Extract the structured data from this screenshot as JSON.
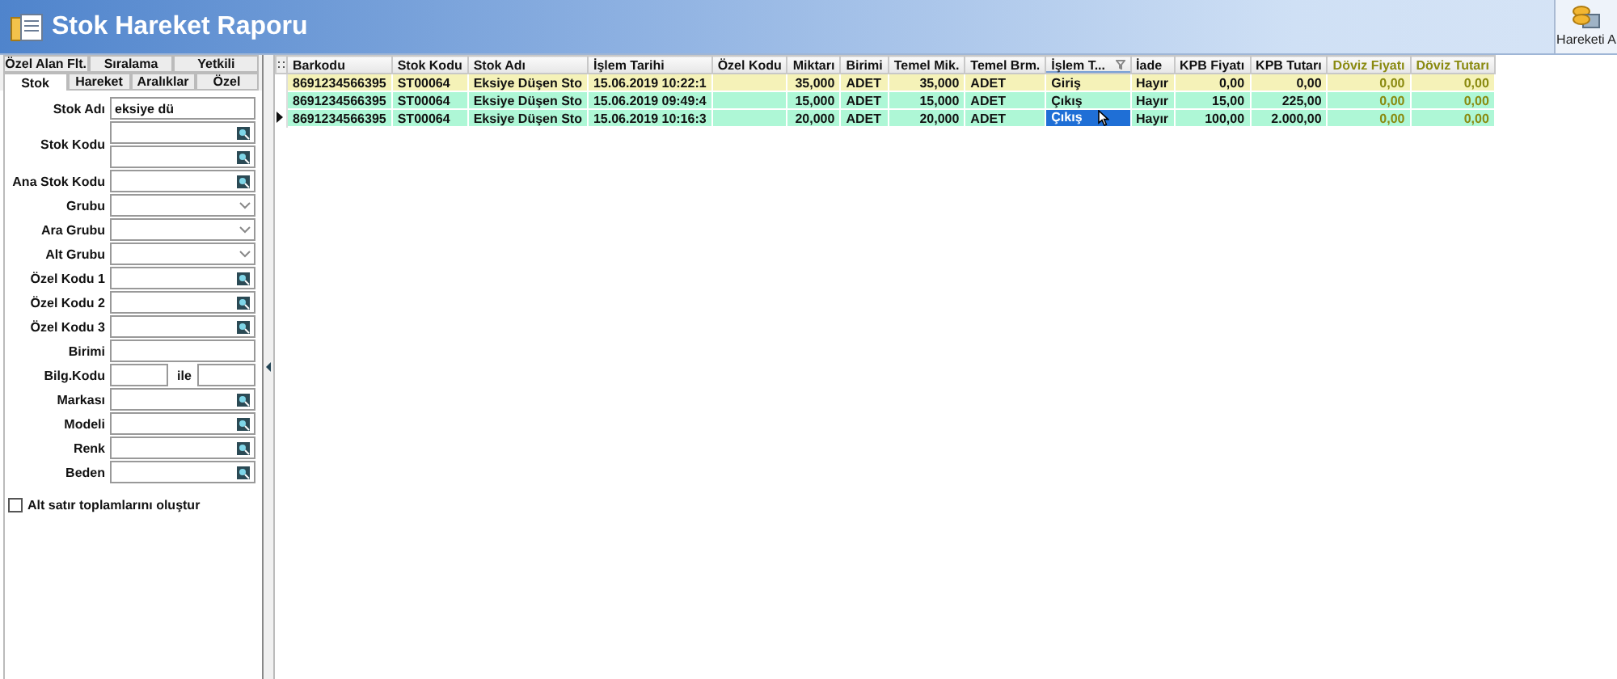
{
  "window": {
    "title": "Stok Hareket Raporu"
  },
  "toolbar": {
    "buttons": [
      {
        "label": "Hareketi A"
      }
    ]
  },
  "filter_tabs_back": [
    {
      "label": "Özel Alan Flt.",
      "selected": false
    },
    {
      "label": "Sıralama",
      "selected": false
    },
    {
      "label": "Yetkili",
      "selected": false
    }
  ],
  "filter_tabs_front": [
    {
      "label": "Stok",
      "selected": true
    },
    {
      "label": "Hareket",
      "selected": false
    },
    {
      "label": "Aralıklar",
      "selected": false
    },
    {
      "label": "Özel",
      "selected": false
    }
  ],
  "filter_fields": [
    {
      "label": "Stok Adı",
      "kind": "text",
      "value": "eksiye dü"
    },
    {
      "label": "Stok Kodu",
      "kind": "lookup-pair"
    },
    {
      "label": "Ana Stok Kodu",
      "kind": "lookup"
    },
    {
      "label": "Grubu",
      "kind": "dropdown"
    },
    {
      "label": "Ara Grubu",
      "kind": "dropdown"
    },
    {
      "label": "Alt Grubu",
      "kind": "dropdown"
    },
    {
      "label": "Özel Kodu 1",
      "kind": "lookup"
    },
    {
      "label": "Özel Kodu 2",
      "kind": "lookup"
    },
    {
      "label": "Özel Kodu 3",
      "kind": "lookup"
    },
    {
      "label": "Birimi",
      "kind": "text"
    },
    {
      "label": "Bilg.Kodu",
      "kind": "range",
      "separator": "ile"
    },
    {
      "label": "Markası",
      "kind": "lookup"
    },
    {
      "label": "Modeli",
      "kind": "lookup"
    },
    {
      "label": "Renk",
      "kind": "lookup"
    },
    {
      "label": "Beden",
      "kind": "lookup"
    }
  ],
  "subtotal_checkbox": {
    "label": "Alt satır toplamlarını oluştur",
    "checked": false
  },
  "table": {
    "columns": [
      {
        "label": "Barkodu",
        "kind": "text",
        "filter": false,
        "focused": false
      },
      {
        "label": "Stok Kodu",
        "kind": "text",
        "filter": false,
        "focused": false
      },
      {
        "label": "Stok Adı",
        "kind": "text",
        "filter": false,
        "focused": false
      },
      {
        "label": "İşlem Tarihi",
        "kind": "text",
        "filter": false,
        "focused": false
      },
      {
        "label": "Özel Kodu",
        "kind": "text",
        "filter": false,
        "focused": false
      },
      {
        "label": "Miktarı",
        "kind": "number",
        "filter": false,
        "focused": false
      },
      {
        "label": "Birimi",
        "kind": "text",
        "filter": false,
        "focused": false
      },
      {
        "label": "Temel Mik.",
        "kind": "number",
        "filter": false,
        "focused": false
      },
      {
        "label": "Temel Brm.",
        "kind": "text",
        "filter": false,
        "focused": false
      },
      {
        "label": "İşlem T...",
        "kind": "text",
        "filter": true,
        "focused": true
      },
      {
        "label": "İade",
        "kind": "text",
        "filter": false,
        "focused": false
      },
      {
        "label": "KPB Fiyatı",
        "kind": "number",
        "filter": false,
        "focused": false
      },
      {
        "label": "KPB Tutarı",
        "kind": "number",
        "filter": false,
        "focused": false
      },
      {
        "label": "Döviz Fiyatı",
        "kind": "foreign",
        "filter": false,
        "focused": false
      },
      {
        "label": "Döviz Tutarı",
        "kind": "foreign",
        "filter": false,
        "focused": false
      }
    ],
    "rows": [
      {
        "color": "#f5f2b8",
        "selected": false,
        "cells": [
          "8691234566395",
          "ST00064",
          "Eksiye Düşen Sto",
          "15.06.2019 10:22:1",
          null,
          "35,000",
          "ADET",
          "35,000",
          "ADET",
          "Giriş",
          "Hayır",
          "0,00",
          "0,00",
          "0,00",
          "0,00"
        ]
      },
      {
        "color": "#aef7d6",
        "selected": false,
        "cells": [
          "8691234566395",
          "ST00064",
          "Eksiye Düşen Sto",
          "15.06.2019 09:49:4",
          null,
          "15,000",
          "ADET",
          "15,000",
          "ADET",
          "Çıkış",
          "Hayır",
          "15,00",
          "225,00",
          "0,00",
          "0,00"
        ]
      },
      {
        "color": "#aef7d6",
        "selected": true,
        "cells": [
          "8691234566395",
          "ST00064",
          "Eksiye Düşen Sto",
          "15.06.2019 10:16:3",
          null,
          "20,000",
          "ADET",
          "20,000",
          "ADET",
          "Çıkış",
          "Hayır",
          "100,00",
          "2.000,00",
          "0,00",
          "0,00"
        ]
      }
    ]
  }
}
